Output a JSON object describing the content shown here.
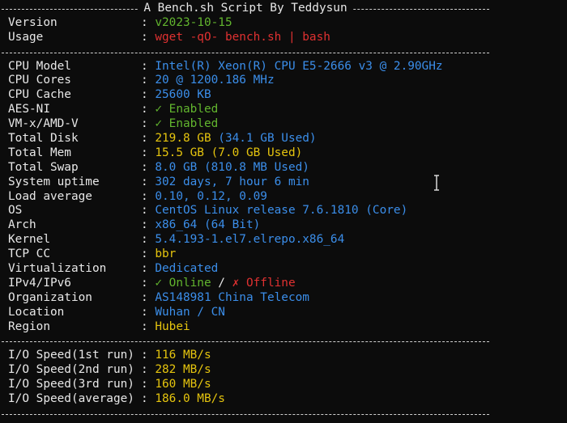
{
  "header": {
    "title": "A Bench.sh Script By Teddysun"
  },
  "script_info": [
    {
      "label": "Version",
      "value": "v2023-10-15",
      "color": "green"
    },
    {
      "label": "Usage",
      "value": "wget -qO- bench.sh | bash",
      "color": "red"
    }
  ],
  "system_info": {
    "cpu_model": {
      "label": "CPU Model",
      "value": "Intel(R) Xeon(R) CPU E5-2666 v3 @ 2.90GHz"
    },
    "cpu_cores": {
      "label": "CPU Cores",
      "value": "20 @ 1200.186 MHz"
    },
    "cpu_cache": {
      "label": "CPU Cache",
      "value": "25600 KB"
    },
    "aes_ni": {
      "label": "AES-NI",
      "value": "✓ Enabled"
    },
    "vmx": {
      "label": "VM-x/AMD-V",
      "value": "✓ Enabled"
    },
    "total_disk": {
      "label": "Total Disk",
      "value": "219.8 GB",
      "extra": " (34.1 GB Used)"
    },
    "total_mem": {
      "label": "Total Mem",
      "value": "15.5 GB",
      "extra": " (7.0 GB Used)"
    },
    "total_swap": {
      "label": "Total Swap",
      "value": "8.0 GB (810.8 MB Used)"
    },
    "uptime": {
      "label": "System uptime",
      "value": "302 days, 7 hour 6 min"
    },
    "load_average": {
      "label": "Load average",
      "value": "0.10, 0.12, 0.09"
    },
    "os": {
      "label": "OS",
      "value": "CentOS Linux release 7.6.1810 (Core)"
    },
    "arch": {
      "label": "Arch",
      "value": "x86_64 (64 Bit)"
    },
    "kernel": {
      "label": "Kernel",
      "value": "5.4.193-1.el7.elrepo.x86_64"
    },
    "tcp_cc": {
      "label": "TCP CC",
      "value": "bbr"
    },
    "virtualization": {
      "label": "Virtualization",
      "value": "Dedicated"
    },
    "ipv4_ipv6": {
      "label": "IPv4/IPv6",
      "online": "✓ Online",
      "slash": " / ",
      "offline": "✗ Offline"
    },
    "organization": {
      "label": "Organization",
      "value": "AS148981 China Telecom"
    },
    "location": {
      "label": "Location",
      "value": "Wuhan / CN"
    },
    "region": {
      "label": "Region",
      "value": "Hubei"
    }
  },
  "io_speed": [
    {
      "label": "I/O Speed(1st run)",
      "value": "116 MB/s"
    },
    {
      "label": "I/O Speed(2nd run)",
      "value": "282 MB/s"
    },
    {
      "label": "I/O Speed(3rd run)",
      "value": "160 MB/s"
    },
    {
      "label": "I/O Speed(average)",
      "value": "186.0 MB/s"
    }
  ],
  "separator": ": ",
  "colors": {
    "background": "#0c0c0c",
    "label": "#e8e8e8",
    "blue": "#3b8eea",
    "green": "#62b52e",
    "red": "#e03131",
    "yellow": "#e5c40e"
  }
}
